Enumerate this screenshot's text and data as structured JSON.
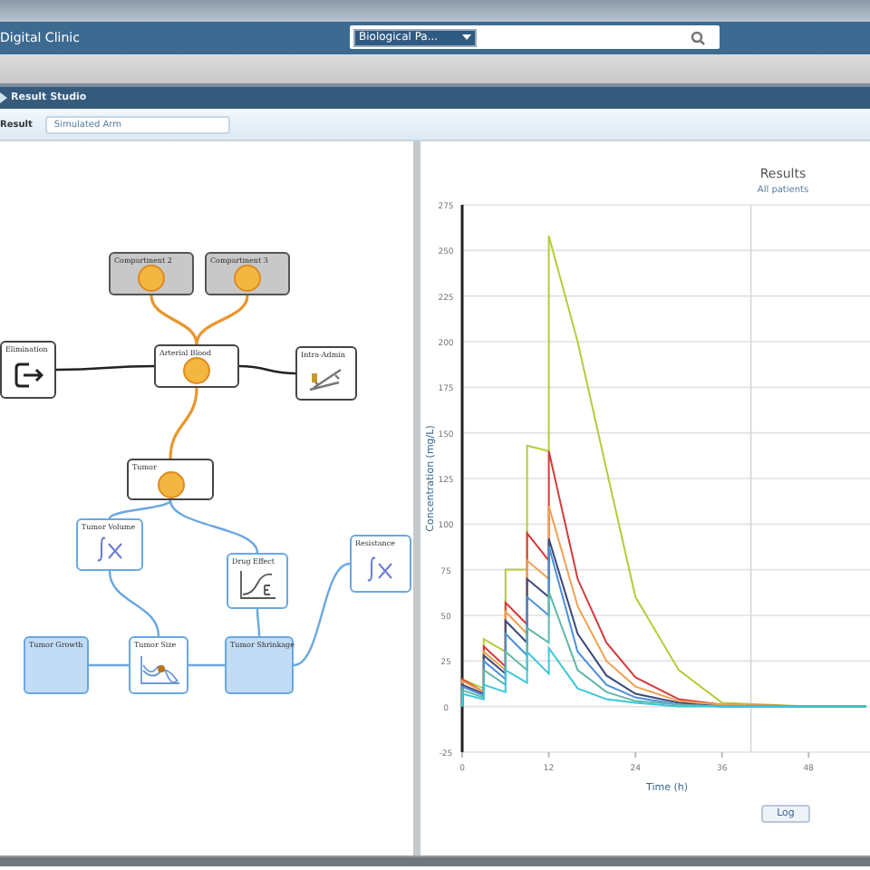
{
  "app_bar": {
    "title": "Digital Clinic",
    "search": {
      "scope": "Biological Pa..."
    }
  },
  "studio_bar": {
    "title": "Result Studio"
  },
  "result_row": {
    "label": "Result",
    "value": "Simulated Arm"
  },
  "diagram": {
    "nodes": [
      {
        "label": "Compartment 2",
        "kind": "compartment"
      },
      {
        "label": "Compartment 3",
        "kind": "compartment"
      },
      {
        "label": "Elimination",
        "kind": "plain"
      },
      {
        "label": "Arterial Blood",
        "kind": "plain"
      },
      {
        "label": "Intra-Admin",
        "kind": "plain"
      },
      {
        "label": "Tumor",
        "kind": "plain"
      },
      {
        "label": "Tumor Volume",
        "kind": "model"
      },
      {
        "label": "Drug Effect",
        "kind": "model"
      },
      {
        "label": "Resistance",
        "kind": "model"
      },
      {
        "label": "Tumor Growth",
        "kind": "filled"
      },
      {
        "label": "Tumor Size",
        "kind": "model"
      },
      {
        "label": "Tumor Shrinkage",
        "kind": "filled"
      }
    ]
  },
  "results": {
    "subtitle": "All patients",
    "button": "Log",
    "chart_data": {
      "type": "line",
      "title": "Results",
      "xlabel": "Time (h)",
      "ylabel": "Concentration (mg/L)",
      "x": [
        0,
        0,
        3,
        3,
        6,
        6,
        9,
        9,
        12,
        12,
        16,
        20,
        24,
        30,
        36,
        48,
        56
      ],
      "xlim": [
        0,
        56
      ],
      "ylim": [
        -25,
        275
      ],
      "grid": true,
      "ref_lines": [
        {
          "axis": "x",
          "value": 40
        }
      ],
      "xticks": [
        0,
        12,
        24,
        36,
        48
      ],
      "yticks": [
        -25,
        0,
        25,
        50,
        75,
        100,
        125,
        150,
        175,
        200,
        225,
        250,
        275
      ],
      "series": [
        {
          "color": "#b5cc3a",
          "values": [
            0,
            15,
            10,
            37,
            30,
            75,
            75,
            143,
            140,
            258,
            200,
            130,
            60,
            20,
            2,
            0,
            0
          ]
        },
        {
          "color": "#d43a3a",
          "values": [
            0,
            15,
            8,
            33,
            22,
            57,
            45,
            95,
            80,
            140,
            70,
            35,
            16,
            4,
            1,
            0,
            0
          ]
        },
        {
          "color": "#f0a050",
          "values": [
            0,
            14,
            8,
            30,
            20,
            52,
            40,
            80,
            70,
            110,
            55,
            25,
            11,
            3,
            1,
            0,
            0
          ]
        },
        {
          "color": "#3c4a7a",
          "values": [
            0,
            12,
            7,
            28,
            18,
            47,
            35,
            70,
            60,
            92,
            40,
            17,
            7,
            2,
            0,
            0,
            0
          ]
        },
        {
          "color": "#4a90d9",
          "values": [
            0,
            11,
            6,
            25,
            15,
            40,
            28,
            60,
            50,
            88,
            30,
            12,
            5,
            1,
            0,
            0,
            0
          ]
        },
        {
          "color": "#5fb8a8",
          "values": [
            0,
            9,
            5,
            20,
            12,
            30,
            20,
            43,
            35,
            63,
            20,
            8,
            3,
            1,
            0,
            0,
            0
          ]
        },
        {
          "color": "#3cc8d8",
          "values": [
            0,
            7,
            4,
            12,
            8,
            20,
            13,
            30,
            18,
            32,
            10,
            4,
            2,
            0,
            0,
            0,
            0
          ]
        }
      ]
    }
  }
}
